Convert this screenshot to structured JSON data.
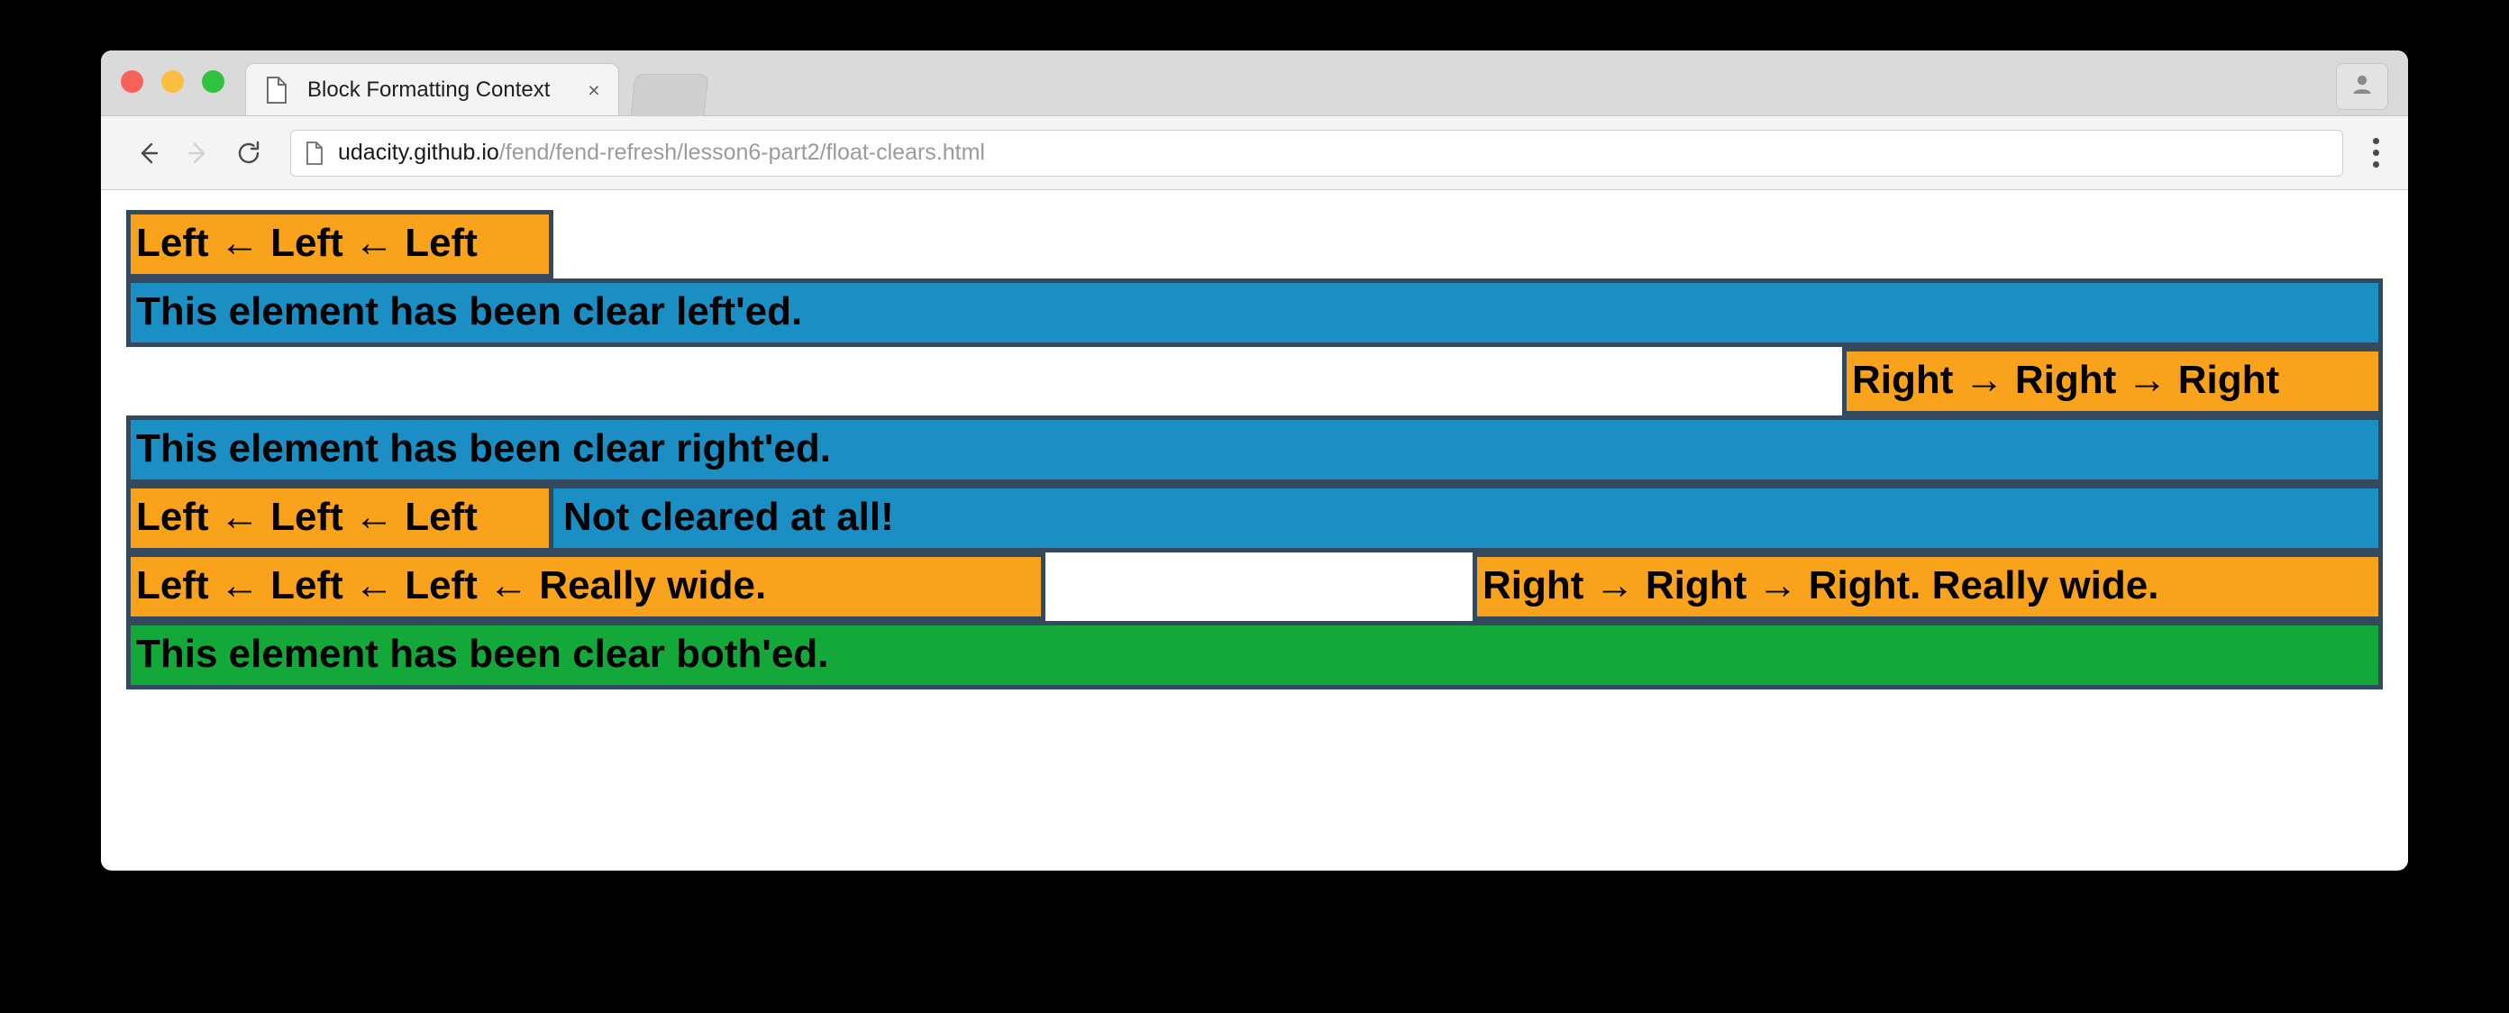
{
  "browser": {
    "traffic_lights": [
      "close",
      "minimize",
      "maximize"
    ],
    "tab": {
      "title": "Block Formatting Context",
      "favicon": "page-document-icon",
      "close_label": "×"
    },
    "toolbar": {
      "back_label": "←",
      "forward_label": "→",
      "reload_label": "⟳",
      "security_icon": "page-info-icon",
      "url_domain": "udacity.github.io",
      "url_path": "/fend/fend-refresh/lesson6-part2/float-clears.html",
      "url_full": "udacity.github.io/fend/fend-refresh/lesson6-part2/float-clears.html",
      "menu_icon": "three-dot-menu-icon"
    },
    "profile_icon": "user-avatar-icon"
  },
  "page": {
    "blocks": {
      "left_float_1": "Left ← Left ← Left",
      "clear_left": "This element has been clear left'ed.",
      "right_float_1": "Right → Right → Right",
      "clear_right": "This element has been clear right'ed.",
      "left_float_2": "Left ← Left ← Left",
      "not_cleared": "Not cleared at all!",
      "left_float_wide": "Left ← Left ← Left ← Really wide.",
      "right_float_wide": "Right → Right → Right. Really wide.",
      "clear_both": "This element has been clear both'ed."
    },
    "colors": {
      "float_orange": "#f9a21b",
      "cleared_blue": "#1b8fc4",
      "clear_both_green": "#14a83a",
      "block_border": "#34495e",
      "page_background": "#ffffff"
    }
  }
}
